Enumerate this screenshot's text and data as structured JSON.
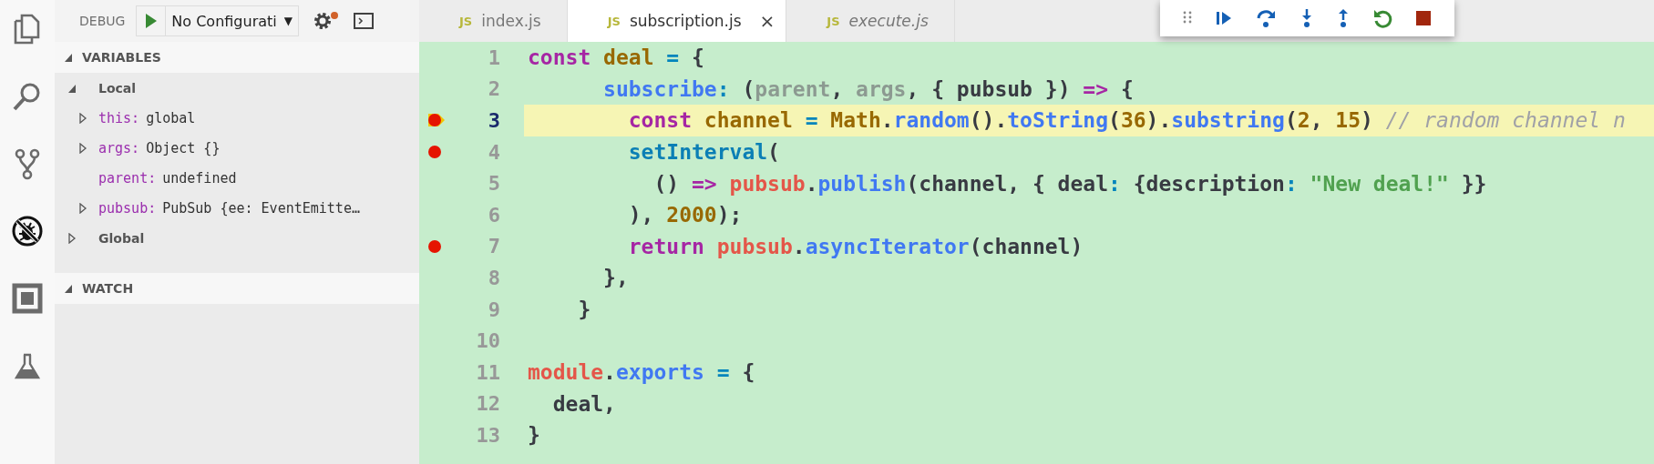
{
  "activity_bar": [
    {
      "kind": "files",
      "selected": false
    },
    {
      "kind": "search",
      "selected": false
    },
    {
      "kind": "source-control",
      "selected": false
    },
    {
      "kind": "debug",
      "selected": true
    },
    {
      "kind": "extensions",
      "selected": false
    },
    {
      "kind": "testing",
      "selected": false
    }
  ],
  "debug_header": {
    "title": "DEBUG",
    "configuration": "No Configurati",
    "dropdown_arrow": "▼"
  },
  "variables": {
    "title": "VARIABLES",
    "expanded": true,
    "scopes": [
      {
        "label": "Local",
        "expanded": true,
        "children": [
          {
            "name": "this:",
            "value": "global",
            "expandable": true
          },
          {
            "name": "args:",
            "value": "Object {}",
            "expandable": true
          },
          {
            "name": "parent:",
            "value": "undefined",
            "expandable": false
          },
          {
            "name": "pubsub:",
            "value": "PubSub {ee: EventEmitte…",
            "expandable": true
          }
        ]
      },
      {
        "label": "Global",
        "expanded": false
      }
    ]
  },
  "watch": {
    "title": "WATCH",
    "expanded": true
  },
  "tabs": [
    {
      "badge": "JS",
      "label": "index.js",
      "selected": false,
      "preview": false
    },
    {
      "badge": "JS",
      "label": "subscription.js",
      "selected": true,
      "preview": false,
      "close": "×"
    },
    {
      "badge": "JS",
      "label": "execute.js",
      "selected": false,
      "preview": true
    }
  ],
  "debug_toolbar": [
    {
      "kind": "grip"
    },
    {
      "kind": "continue"
    },
    {
      "kind": "step-over"
    },
    {
      "kind": "step-into"
    },
    {
      "kind": "step-out"
    },
    {
      "kind": "restart"
    },
    {
      "kind": "stop"
    }
  ],
  "editor": {
    "lines": [
      {
        "number": "1",
        "breakpoint": false,
        "current": false,
        "tokens": [
          {
            "text": "const",
            "kind": "kw"
          },
          {
            "text": " deal",
            "kind": "var"
          },
          {
            "text": " = ",
            "kind": "op"
          },
          {
            "text": "{",
            "kind": "punct"
          }
        ]
      },
      {
        "number": "2",
        "breakpoint": false,
        "current": false,
        "tokens": [
          {
            "text": "      subscribe",
            "kind": "fn"
          },
          {
            "text": ": ",
            "kind": "op"
          },
          {
            "text": "(",
            "kind": "punct"
          },
          {
            "text": "parent",
            "kind": "param"
          },
          {
            "text": ", ",
            "kind": "punct"
          },
          {
            "text": "args",
            "kind": "param"
          },
          {
            "text": ", { pubsub }) ",
            "kind": "punct"
          },
          {
            "text": "=>",
            "kind": "kw"
          },
          {
            "text": " {",
            "kind": "punct"
          }
        ]
      },
      {
        "number": "3",
        "breakpoint": true,
        "current": true,
        "tokens": [
          {
            "text": "        const",
            "kind": "kw"
          },
          {
            "text": " channel",
            "kind": "var"
          },
          {
            "text": " = ",
            "kind": "op"
          },
          {
            "text": "Math",
            "kind": "var"
          },
          {
            "text": ".",
            "kind": "punct"
          },
          {
            "text": "random",
            "kind": "fn"
          },
          {
            "text": "().",
            "kind": "punct"
          },
          {
            "text": "toString",
            "kind": "fn"
          },
          {
            "text": "(",
            "kind": "punct"
          },
          {
            "text": "36",
            "kind": "num"
          },
          {
            "text": ").",
            "kind": "punct"
          },
          {
            "text": "substring",
            "kind": "fn"
          },
          {
            "text": "(",
            "kind": "punct"
          },
          {
            "text": "2",
            "kind": "num"
          },
          {
            "text": ", ",
            "kind": "punct"
          },
          {
            "text": "15",
            "kind": "num"
          },
          {
            "text": ") ",
            "kind": "punct"
          },
          {
            "text": "// random channel n",
            "kind": "comment"
          }
        ]
      },
      {
        "number": "4",
        "breakpoint": true,
        "current": false,
        "tokens": [
          {
            "text": "        setInterval",
            "kind": "builtin"
          },
          {
            "text": "(",
            "kind": "punct"
          }
        ]
      },
      {
        "number": "5",
        "breakpoint": false,
        "current": false,
        "tokens": [
          {
            "text": "          () ",
            "kind": "punct"
          },
          {
            "text": "=>",
            "kind": "kw"
          },
          {
            "text": " pubsub",
            "kind": "obj"
          },
          {
            "text": ".",
            "kind": "punct"
          },
          {
            "text": "publish",
            "kind": "fn"
          },
          {
            "text": "(channel, { deal",
            "kind": "punct"
          },
          {
            "text": ": ",
            "kind": "op"
          },
          {
            "text": "{description",
            "kind": "punct"
          },
          {
            "text": ": ",
            "kind": "op"
          },
          {
            "text": "\"New deal!\"",
            "kind": "str"
          },
          {
            "text": " }}",
            "kind": "punct"
          }
        ]
      },
      {
        "number": "6",
        "breakpoint": false,
        "current": false,
        "tokens": [
          {
            "text": "        ), ",
            "kind": "punct"
          },
          {
            "text": "2000",
            "kind": "num"
          },
          {
            "text": ");",
            "kind": "punct"
          }
        ]
      },
      {
        "number": "7",
        "breakpoint": true,
        "current": false,
        "tokens": [
          {
            "text": "        return",
            "kind": "kw"
          },
          {
            "text": " pubsub",
            "kind": "obj"
          },
          {
            "text": ".",
            "kind": "punct"
          },
          {
            "text": "asyncIterator",
            "kind": "fn"
          },
          {
            "text": "(channel)",
            "kind": "punct"
          }
        ]
      },
      {
        "number": "8",
        "breakpoint": false,
        "current": false,
        "tokens": [
          {
            "text": "      },",
            "kind": "punct"
          }
        ]
      },
      {
        "number": "9",
        "breakpoint": false,
        "current": false,
        "tokens": [
          {
            "text": "    }",
            "kind": "punct"
          }
        ]
      },
      {
        "number": "10",
        "breakpoint": false,
        "current": false
      },
      {
        "number": "11",
        "breakpoint": false,
        "current": false,
        "tokens": [
          {
            "text": "module",
            "kind": "obj"
          },
          {
            "text": ".",
            "kind": "punct"
          },
          {
            "text": "exports",
            "kind": "fn"
          },
          {
            "text": " = ",
            "kind": "op"
          },
          {
            "text": "{",
            "kind": "punct"
          }
        ]
      },
      {
        "number": "12",
        "breakpoint": false,
        "current": false,
        "tokens": [
          {
            "text": "  deal,",
            "kind": "punct"
          }
        ]
      },
      {
        "number": "13",
        "breakpoint": false,
        "current": false,
        "tokens": [
          {
            "text": "}",
            "kind": "punct"
          }
        ]
      }
    ]
  }
}
